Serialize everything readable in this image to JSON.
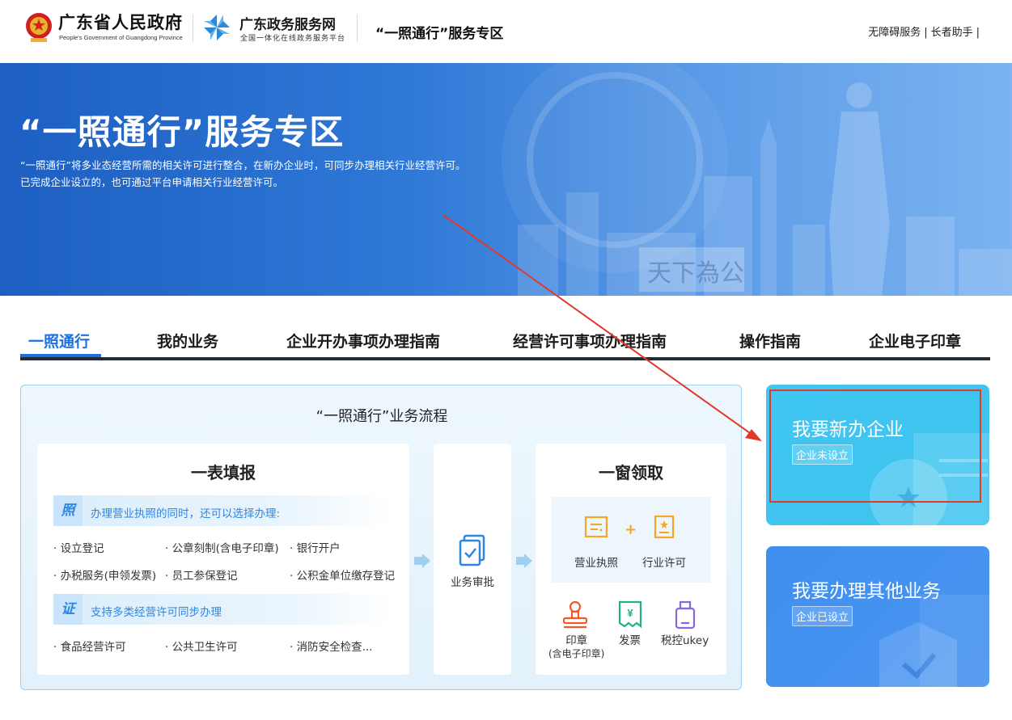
{
  "header": {
    "gov_title": "广东省人民政府",
    "gov_subtitle": "People's Government of Guangdong Province",
    "service_title": "广东政务服务网",
    "service_subtitle": "全国一体化在线政务服务平台",
    "zone_title": "“一照通行”服务专区",
    "links": [
      "无障碍服务",
      "长者助手"
    ],
    "link_separator": "|"
  },
  "banner": {
    "title": "“一照通行”服务专区",
    "desc_line1": "“一照通行”将多业态经营所需的相关许可进行整合，在新办企业时，可同步办理相关行业经营许可。",
    "desc_line2": "已完成企业设立的，也可通过平台申请相关行业经营许可。",
    "background_text": "天下為公"
  },
  "tabs": [
    {
      "label": "一照通行",
      "active": true
    },
    {
      "label": "我的业务",
      "active": false
    },
    {
      "label": "企业开办事项办理指南",
      "active": false
    },
    {
      "label": "经营许可事项办理指南",
      "active": false
    },
    {
      "label": "操作指南",
      "active": false
    },
    {
      "label": "企业电子印章",
      "active": false
    }
  ],
  "flow": {
    "title": "“一照通行”业务流程",
    "step1": {
      "title": "一表填报",
      "license_badge": "照",
      "license_note": "办理营业执照的同时，还可以选择办理:",
      "license_items": [
        "· 设立登记",
        "· 公章刻制(含电子印章)",
        "· 银行开户",
        "· 办税服务(申领发票)",
        "· 员工参保登记",
        "· 公积金单位缴存登记"
      ],
      "permit_badge": "证",
      "permit_note": "支持多类经营许可同步办理",
      "permit_items": [
        "· 食品经营许可",
        "· 公共卫生许可",
        "· 消防安全检查..."
      ]
    },
    "step2": {
      "label": "业务审批"
    },
    "step3": {
      "title": "一窗领取",
      "plus": "+",
      "license_label": "营业执照",
      "permit_label": "行业许可",
      "seal_label": "印章",
      "seal_sub": "(含电子印章)",
      "invoice_label": "发票",
      "ukey_label": "税控ukey",
      "invoice_symbol": "¥"
    }
  },
  "actions": [
    {
      "title": "我要新办企业",
      "tag": "企业未设立",
      "color": "#41c6f2"
    },
    {
      "title": "我要办理其他业务",
      "tag": "企业已设立",
      "color": "#3f8ff0"
    }
  ],
  "colors": {
    "accent": "#1f6fde",
    "highlight": "#e03b2a",
    "strip_text": "#2f86e0",
    "icon_orange": "#f5a623"
  }
}
